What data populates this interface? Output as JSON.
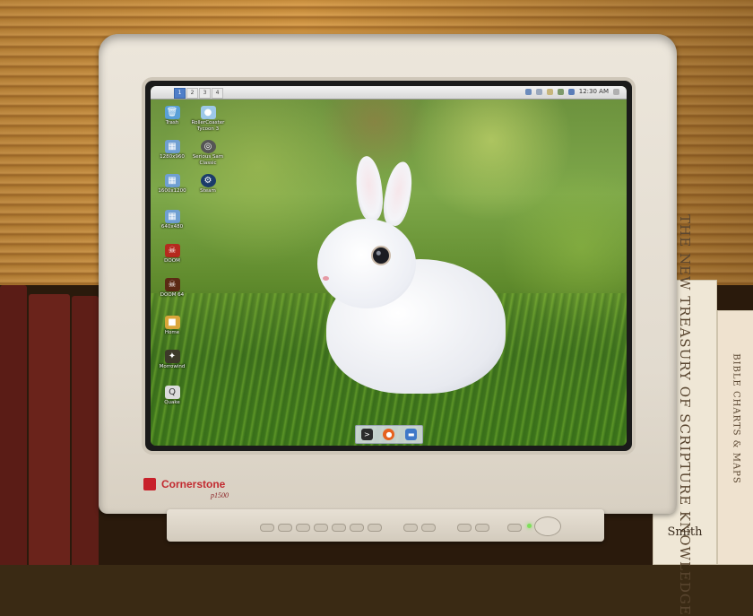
{
  "taskbar": {
    "workspaces": [
      "1",
      "2",
      "3",
      "4"
    ],
    "active_workspace": "1",
    "clock": "12:30 AM"
  },
  "desktop_icons": [
    {
      "label": "Trash",
      "icon": "trash-icon"
    },
    {
      "label": "RollerCoaster Tycoon 3",
      "icon": "rollercoaster-tycoon-icon"
    },
    {
      "label": "1280x960",
      "icon": "resolution-icon"
    },
    {
      "label": "Serious Sam Classic",
      "icon": "serious-sam-icon"
    },
    {
      "label": "1600x1200",
      "icon": "resolution-icon"
    },
    {
      "label": "Steam",
      "icon": "steam-icon"
    },
    {
      "label": "640x480",
      "icon": "resolution-icon"
    },
    {
      "label": "DOOM",
      "icon": "doom-icon"
    },
    {
      "label": "DOOM 64",
      "icon": "doom64-icon"
    },
    {
      "label": "Home",
      "icon": "folder-icon"
    },
    {
      "label": "Morrowind",
      "icon": "morrowind-icon"
    },
    {
      "label": "Quake",
      "icon": "quake-icon"
    }
  ],
  "dock": [
    "terminal-icon",
    "firefox-icon",
    "files-icon"
  ],
  "monitor": {
    "brand": "Cornerstone",
    "model": "p1500"
  },
  "books": {
    "right_title": "THE NEW TREASURY OF SCRIPTURE KNOWLEDGE",
    "right_author": "Smith",
    "far_right": "BIBLE CHARTS & MAPS"
  }
}
